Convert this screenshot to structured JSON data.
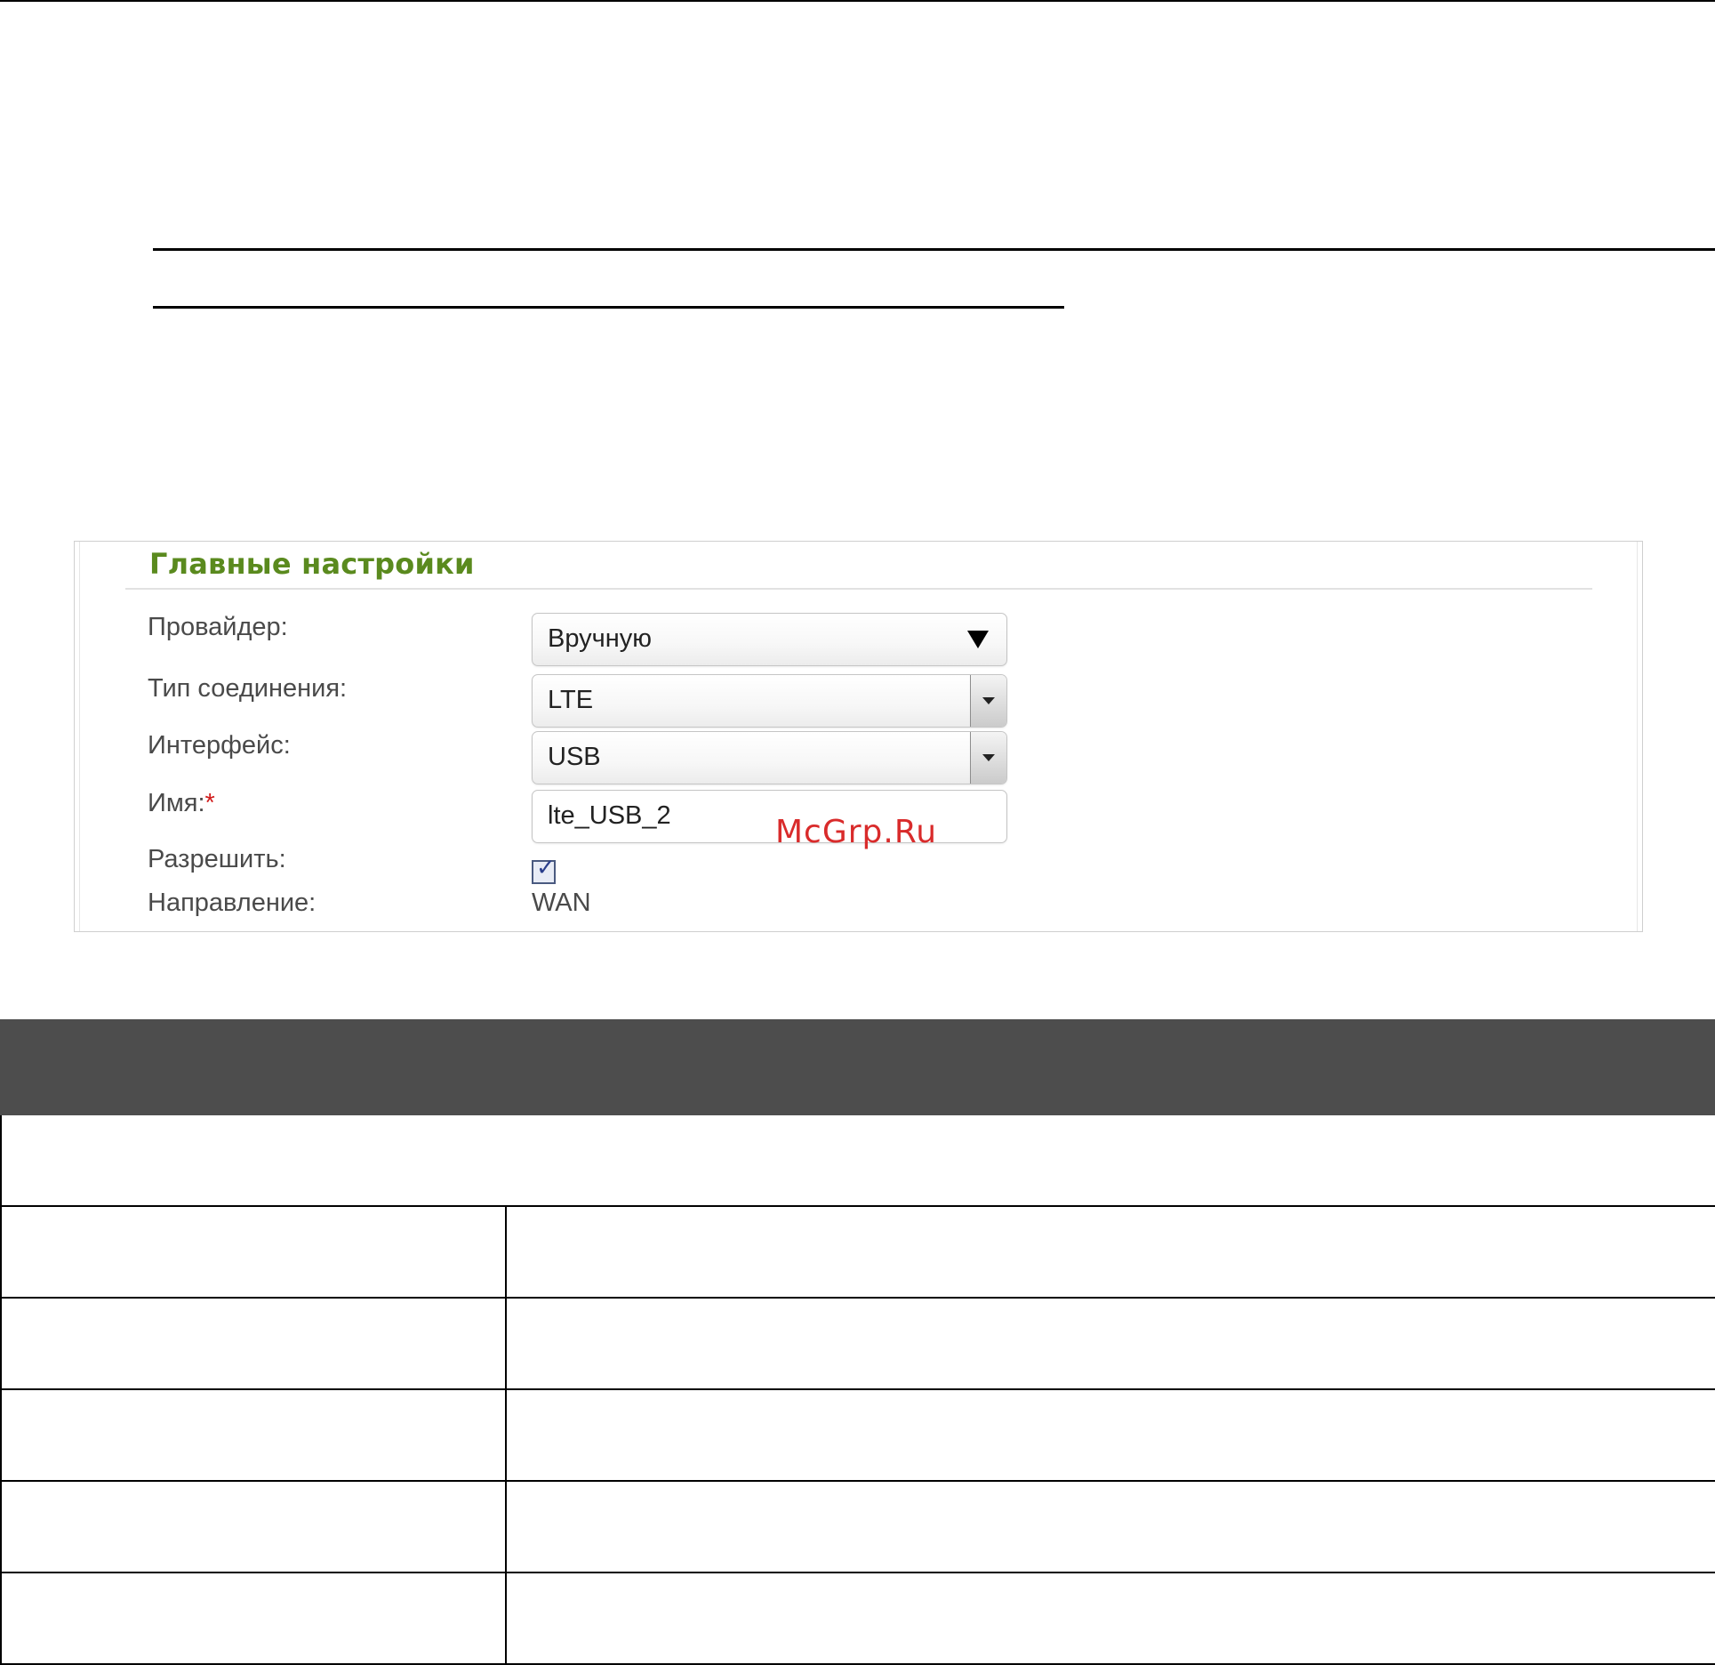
{
  "settings": {
    "section_title": "Главные настройки",
    "fields": {
      "provider": {
        "label": "Провайдер:",
        "value": "Вручную"
      },
      "connection_type": {
        "label": "Тип соединения:",
        "value": "LTE"
      },
      "interface": {
        "label": "Интерфейс:",
        "value": "USB"
      },
      "name": {
        "label": "Имя:",
        "required_mark": "*",
        "value": "lte_USB_2"
      },
      "enable": {
        "label": "Разрешить:",
        "checked": true
      },
      "direction": {
        "label": "Направление:",
        "value": "WAN"
      }
    }
  },
  "watermark": "McGrp.Ru",
  "icons": {
    "provider_dropdown": "triangle-down-icon",
    "select_arrow": "chevron-down-icon",
    "checkbox": "checkmark-icon"
  },
  "colors": {
    "section_title": "#5a8a1e",
    "required_mark": "#d11b1b",
    "watermark": "#d92b2b",
    "table_header": "#4d4d4d"
  }
}
